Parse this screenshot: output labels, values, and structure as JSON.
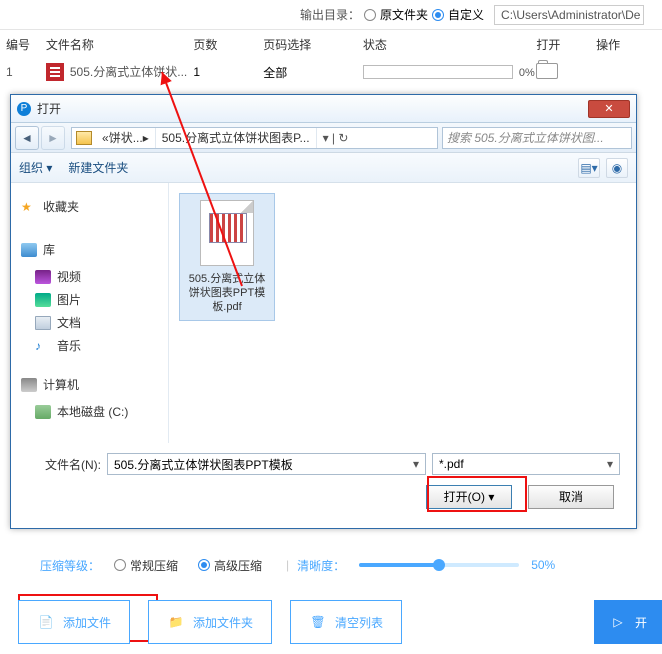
{
  "topbar": {
    "output_label": "输出目录：",
    "opt_original": "原文件夹",
    "opt_custom": "自定义",
    "path": "C:\\Users\\Administrator\\De"
  },
  "columns": {
    "id": "编号",
    "name": "文件名称",
    "pages": "页数",
    "pagesel": "页码选择",
    "status": "状态",
    "open": "打开",
    "op": "操作"
  },
  "row": {
    "id": "1",
    "name": "505.分离式立体饼状...",
    "pages": "1",
    "pagesel": "全部",
    "progress": "0%"
  },
  "dialog": {
    "title": "打开",
    "breadcrumb_seg": "饼状...",
    "breadcrumb_file": "505.分离式立体饼状图表P...",
    "search_placeholder": "搜索 505.分离式立体饼状图...",
    "toolbar_org": "组织 ▾",
    "toolbar_new": "新建文件夹",
    "sidebar": {
      "fav": "收藏夹",
      "lib": "库",
      "video": "视频",
      "pic": "图片",
      "doc": "文档",
      "music": "音乐",
      "computer": "计算机",
      "disk": "本地磁盘 (C:)"
    },
    "file": "505.分离式立体饼状图表PPT模板.pdf",
    "filename_label": "文件名(N):",
    "filename_value": "505.分离式立体饼状图表PPT模板",
    "filter": "*.pdf",
    "open_btn": "打开(O)",
    "cancel_btn": "取消"
  },
  "compress": {
    "label": "压缩等级：",
    "normal": "常规压缩",
    "advanced": "高级压缩",
    "clarity_label": "清晰度：",
    "percent": "50%"
  },
  "bottom": {
    "add_file": "添加文件",
    "add_folder": "添加文件夹",
    "clear": "清空列表",
    "start": "开"
  }
}
